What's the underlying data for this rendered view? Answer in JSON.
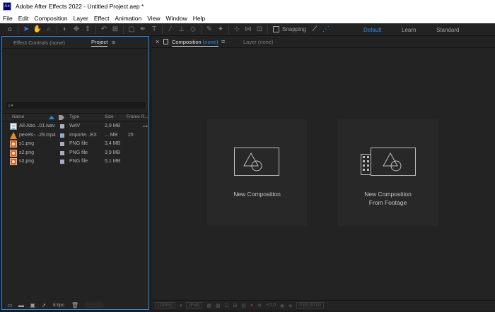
{
  "window": {
    "app_icon_text": "Ae",
    "title": "Adobe After Effects 2022 - Untitled Project.aep *"
  },
  "menu": [
    "File",
    "Edit",
    "Composition",
    "Layer",
    "Effect",
    "Animation",
    "View",
    "Window",
    "Help"
  ],
  "toolbar": {
    "snapping_label": "Snapping",
    "workspaces": {
      "default": "Default",
      "learn": "Learn",
      "standard": "Standard"
    }
  },
  "left_panel": {
    "tab_effect_controls": "Effect Controls (none)",
    "tab_project": "Project",
    "search_placeholder": "⌕▾",
    "columns": {
      "name": "Name",
      "type": "Type",
      "size": "Size",
      "frame_rate": "Frame R..."
    },
    "files": [
      {
        "name": "All-Abo...01.wav",
        "type": "WAV",
        "size": "2,9 MB",
        "frame_rate": "",
        "icon": "audio-file-icon",
        "label_color": "#a8b4c8"
      },
      {
        "name": "pexels-...29.mp4",
        "type": "Importe...EX",
        "size": "... MB",
        "frame_rate": "25",
        "icon": "video-file-icon",
        "label_color": "#8fb0c8"
      },
      {
        "name": "s1.png",
        "type": "PNG file",
        "size": "3,4 MB",
        "frame_rate": "",
        "icon": "image-file-icon",
        "label_color": "#b0a8c8"
      },
      {
        "name": "s2.png",
        "type": "PNG file",
        "size": "3,9 MB",
        "frame_rate": "",
        "icon": "image-file-icon",
        "label_color": "#b0a8c8"
      },
      {
        "name": "s3.png",
        "type": "PNG file",
        "size": "5,1 MB",
        "frame_rate": "",
        "icon": "image-file-icon",
        "label_color": "#b0a8c8"
      }
    ],
    "bpc_label": "8 bpc"
  },
  "right_panel": {
    "tab_composition": "Composition",
    "tab_composition_state": "(none)",
    "tab_layer": "Layer (none)",
    "new_composition": "New Composition",
    "new_comp_from_footage_line1": "New Composition",
    "new_comp_from_footage_line2": "From Footage",
    "viewer": {
      "zoom": "(100%)",
      "resolution": "(Full)",
      "exposure": "+0,0",
      "timecode": "0:00:00:00"
    }
  },
  "colors": {
    "accent": "#2d8ceb",
    "panel_bg": "#232323",
    "app_bg": "#1d1d1d"
  }
}
